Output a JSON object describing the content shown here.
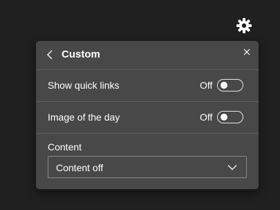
{
  "header": {
    "settings_icon": "gear-icon"
  },
  "panel": {
    "title": "Custom",
    "back_icon": "chevron-left-icon",
    "close_icon": "close-icon"
  },
  "settings": [
    {
      "label": "Show quick links",
      "state": "Off",
      "enabled": false
    },
    {
      "label": "Image of the day",
      "state": "Off",
      "enabled": false
    }
  ],
  "content": {
    "label": "Content",
    "selected": "Content off",
    "chevron_icon": "chevron-down-icon"
  },
  "colors": {
    "page_background": "#202020",
    "panel_background": "#484848",
    "text": "#ffffff"
  }
}
